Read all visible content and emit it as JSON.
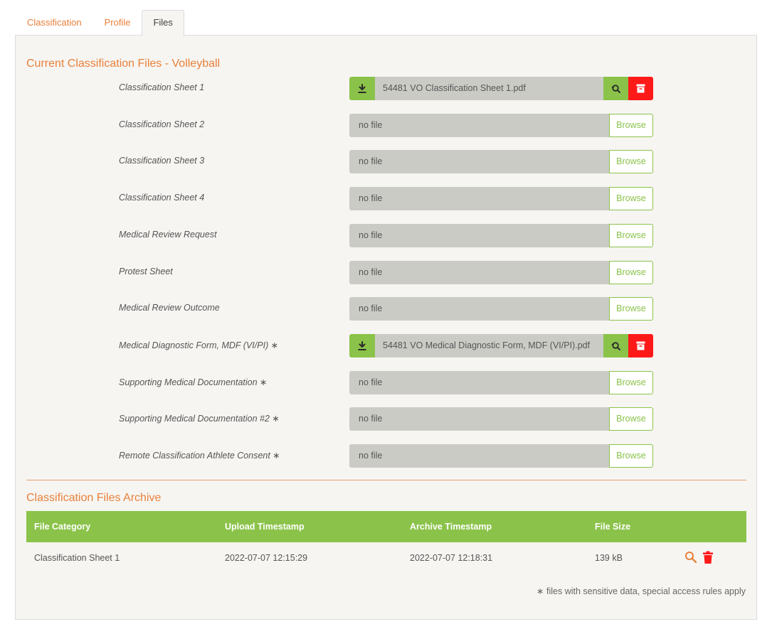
{
  "tabs": [
    {
      "label": "Classification",
      "active": false
    },
    {
      "label": "Profile",
      "active": false
    },
    {
      "label": "Files",
      "active": true
    }
  ],
  "current": {
    "title": "Current Classification Files - Volleyball",
    "rows": [
      {
        "label": "Classification Sheet 1",
        "file": "54481 VO Classification Sheet 1.pdf",
        "has_file": true
      },
      {
        "label": "Classification Sheet 2",
        "file": "no file",
        "has_file": false,
        "button": "Browse"
      },
      {
        "label": "Classification Sheet 3",
        "file": "no file",
        "has_file": false,
        "button": "Browse"
      },
      {
        "label": "Classification Sheet 4",
        "file": "no file",
        "has_file": false,
        "button": "Browse"
      },
      {
        "label": "Medical Review Request",
        "file": "no file",
        "has_file": false,
        "button": "Browse"
      },
      {
        "label": "Protest Sheet",
        "file": "no file",
        "has_file": false,
        "button": "Browse"
      },
      {
        "label": "Medical Review Outcome",
        "file": "no file",
        "has_file": false,
        "button": "Browse"
      },
      {
        "label": "Medical Diagnostic Form, MDF (VI/PI) ∗",
        "file": "54481 VO Medical Diagnostic Form, MDF (VI/PI).pdf",
        "has_file": true
      },
      {
        "label": "Supporting Medical Documentation ∗",
        "file": "no file",
        "has_file": false,
        "button": "Browse"
      },
      {
        "label": "Supporting Medical Documentation #2 ∗",
        "file": "no file",
        "has_file": false,
        "button": "Browse"
      },
      {
        "label": "Remote Classification Athlete Consent ∗",
        "file": "no file",
        "has_file": false,
        "button": "Browse"
      }
    ]
  },
  "archive": {
    "title": "Classification Files Archive",
    "columns": [
      "File Category",
      "Upload Timestamp",
      "Archive Timestamp",
      "File Size"
    ],
    "rows": [
      {
        "category": "Classification Sheet 1",
        "upload": "2022-07-07 12:15:29",
        "archived": "2022-07-07 12:18:31",
        "size": "139 kB"
      }
    ]
  },
  "footnote": "∗ files with sensitive data, special access rules apply",
  "colors": {
    "accent": "#e8803a",
    "green": "#8bc34a",
    "red": "#ff1a1a",
    "panel": "#f6f5f2",
    "field": "#cbcbc6"
  },
  "icons": {
    "download": "download-icon",
    "replace": "replace-icon",
    "delete": "archive-delete-icon",
    "search": "search-icon",
    "trash": "trash-icon"
  }
}
